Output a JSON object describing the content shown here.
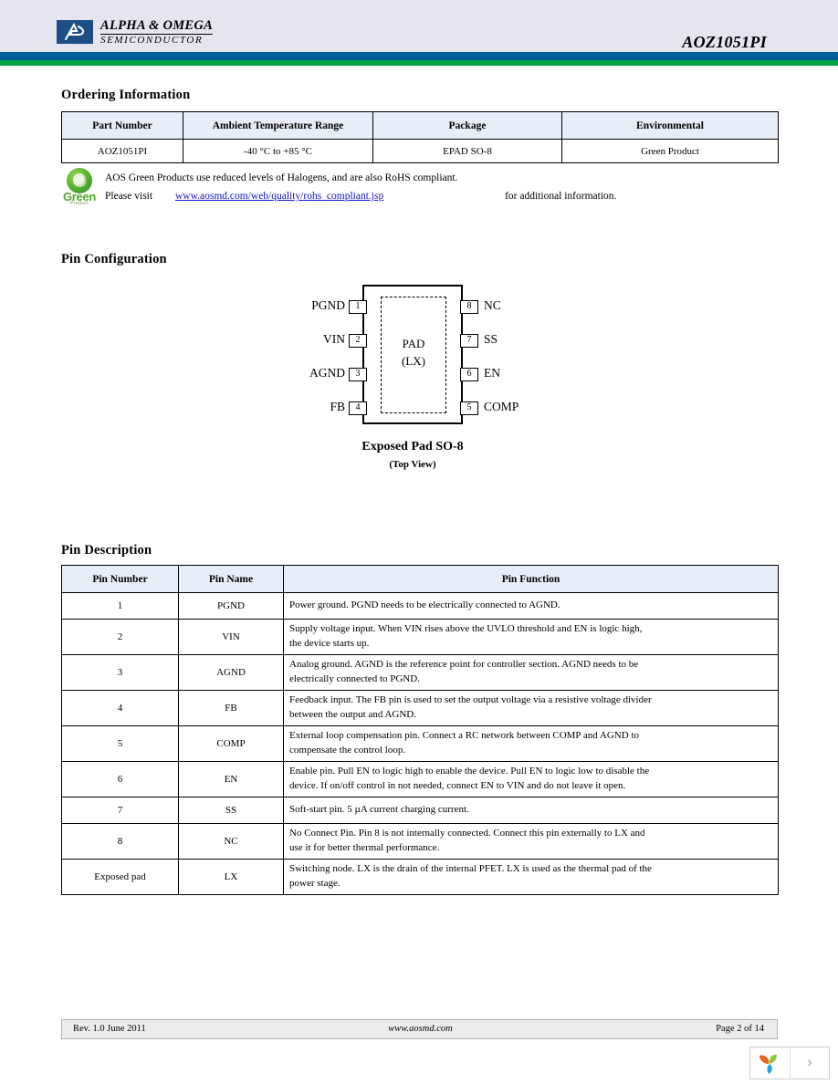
{
  "header": {
    "brand_line1": "ALPHA & OMEGA",
    "brand_line2": "SEMICONDUCTOR",
    "part_number": "AOZ1051PI",
    "bar_blue": "#005b99",
    "bar_green": "#00a14b",
    "background": "#e4e5ef"
  },
  "ordering": {
    "title": "Ordering Information",
    "columns": [
      "Part Number",
      "Ambient Temperature Range",
      "Package",
      "Environmental"
    ],
    "rows": [
      [
        "AOZ1051PI",
        "-40 °C to +85 °C",
        "EPAD SO-8",
        "Green Product"
      ]
    ]
  },
  "green_note": {
    "logo_label": "Green",
    "logo_sublabel": "Product",
    "line1": "AOS Green Products use reduced levels of Halogens, and are also RoHS compliant.",
    "line2_prefix": "Please visit",
    "link_text": "www.aosmd.com/web/quality/rohs_compliant.jsp",
    "line2_suffix": "for additional information.",
    "link_color": "#1414cc"
  },
  "pin_configuration": {
    "title": "Pin Configuration",
    "pad_line1": "PAD",
    "pad_line2": "(LX)",
    "caption": "Exposed Pad SO-8",
    "subcaption": "(Top View)",
    "left_pins": [
      {
        "number": "1",
        "label": "PGND"
      },
      {
        "number": "2",
        "label": "VIN"
      },
      {
        "number": "3",
        "label": "AGND"
      },
      {
        "number": "4",
        "label": "FB"
      }
    ],
    "right_pins": [
      {
        "number": "8",
        "label": "NC"
      },
      {
        "number": "7",
        "label": "SS"
      },
      {
        "number": "6",
        "label": "EN"
      },
      {
        "number": "5",
        "label": "COMP"
      }
    ]
  },
  "pin_description": {
    "title": "Pin Description",
    "columns": [
      "Pin Number",
      "Pin Name",
      "Pin Function"
    ],
    "rows": [
      {
        "number": "1",
        "name": "PGND",
        "function_l1": "Power ground. PGND needs to be electrically connected to AGND.",
        "function_l2": ""
      },
      {
        "number": "2",
        "name": "VIN",
        "function_l1": "Supply voltage input. When VIN rises above the UVLO threshold and EN is logic high,",
        "function_l2": "the device starts up."
      },
      {
        "number": "3",
        "name": "AGND",
        "function_l1": "Analog ground. AGND is the reference point for controller section. AGND needs to be",
        "function_l2": "electrically connected to PGND."
      },
      {
        "number": "4",
        "name": "FB",
        "function_l1": "Feedback input. The FB pin is used to set the output voltage via a resistive voltage divider",
        "function_l2": "between the output and AGND."
      },
      {
        "number": "5",
        "name": "COMP",
        "function_l1": "External loop compensation pin. Connect a RC network between COMP and AGND to",
        "function_l2": "compensate the control loop."
      },
      {
        "number": "6",
        "name": "EN",
        "function_l1": "Enable pin. Pull EN to logic high to enable the device. Pull EN to logic low to disable the",
        "function_l2": "device. If on/off control in not needed, connect EN to VIN and do not leave it open."
      },
      {
        "number": "7",
        "name": "SS",
        "function_l1": "Soft-start pin. 5 µA current charging current.",
        "function_l2": ""
      },
      {
        "number": "8",
        "name": "NC",
        "function_l1": "No Connect Pin. Pin 8 is not internally connected. Connect this pin externally to LX and",
        "function_l2": "use it for better thermal performance."
      },
      {
        "number": "Exposed pad",
        "name": "LX",
        "function_l1": "Switching node. LX is the drain of the internal PFET. LX is used as the thermal pad of the",
        "function_l2": "power stage."
      }
    ]
  },
  "footer": {
    "revision": "Rev. 1.0 June 2011",
    "url": "www.aosmd.com",
    "page": "Page 2 of 14"
  },
  "viewer": {
    "next_glyph": "›"
  }
}
